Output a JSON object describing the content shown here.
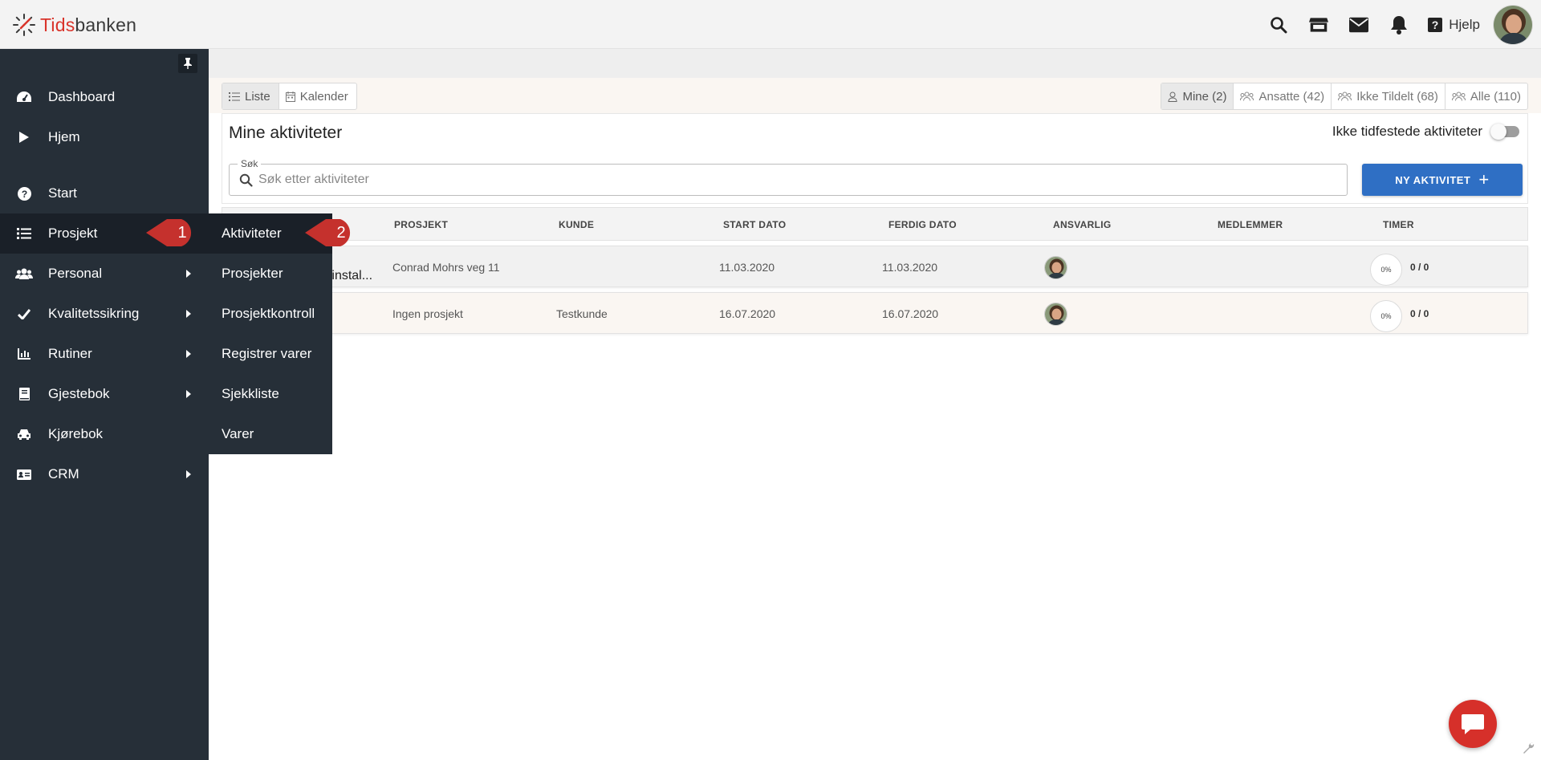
{
  "header": {
    "logo_part1": "Tids",
    "logo_part2": "banken",
    "help_label": "Hjelp"
  },
  "sidebar": {
    "items": [
      {
        "label": "Dashboard",
        "icon": "dashboard-icon"
      },
      {
        "label": "Hjem",
        "icon": "play-icon"
      },
      {
        "label": "Start",
        "icon": "question-circle-icon"
      },
      {
        "label": "Prosjekt",
        "icon": "list-icon",
        "active": true
      },
      {
        "label": "Personal",
        "icon": "users-icon",
        "has_submenu": true
      },
      {
        "label": "Kvalitetssikring",
        "icon": "check-icon",
        "has_submenu": true
      },
      {
        "label": "Rutiner",
        "icon": "chart-icon",
        "has_submenu": true
      },
      {
        "label": "Gjestebok",
        "icon": "book-icon",
        "has_submenu": true
      },
      {
        "label": "Kjørebok",
        "icon": "car-icon"
      },
      {
        "label": "CRM",
        "icon": "id-card-icon",
        "has_submenu": true
      }
    ]
  },
  "submenu": {
    "items": [
      {
        "label": "Aktiviteter",
        "active": true
      },
      {
        "label": "Prosjekter"
      },
      {
        "label": "Prosjektkontroll"
      },
      {
        "label": "Registrer varer"
      },
      {
        "label": "Sjekkliste"
      },
      {
        "label": "Varer"
      }
    ]
  },
  "callouts": {
    "first": "1",
    "second": "2"
  },
  "toolbar": {
    "view_list": "Liste",
    "view_calendar": "Kalender",
    "filters": [
      {
        "label": "Mine (2)",
        "active": true
      },
      {
        "label": "Ansatte (42)"
      },
      {
        "label": "Ikke Tildelt (68)"
      },
      {
        "label": "Alle (110)"
      }
    ]
  },
  "panel": {
    "title": "Mine aktiviteter",
    "toggle_label": "Ikke tidfestede aktiviteter",
    "search_legend": "Søk",
    "search_placeholder": "Søk etter aktiviteter",
    "new_button": "NY AKTIVITET"
  },
  "table": {
    "columns": [
      "PROSJEKT",
      "KUNDE",
      "START DATO",
      "FERDIG DATO",
      "ANSVARLIG",
      "MEDLEMMER",
      "TIMER"
    ],
    "rows": [
      {
        "name": "Vinstal...",
        "project": "Conrad Mohrs veg 11",
        "customer": "",
        "start": "11.03.2020",
        "end": "11.03.2020",
        "progress": "0%",
        "hours": "0 / 0"
      },
      {
        "name": "",
        "project": "Ingen prosjekt",
        "customer": "Testkunde",
        "start": "16.07.2020",
        "end": "16.07.2020",
        "progress": "0%",
        "hours": "0 / 0"
      }
    ]
  },
  "colors": {
    "sidebar_bg": "#262f38",
    "accent_blue": "#2f6fc4",
    "brand_red": "#d9342b",
    "callout_red": "#c5312d"
  }
}
